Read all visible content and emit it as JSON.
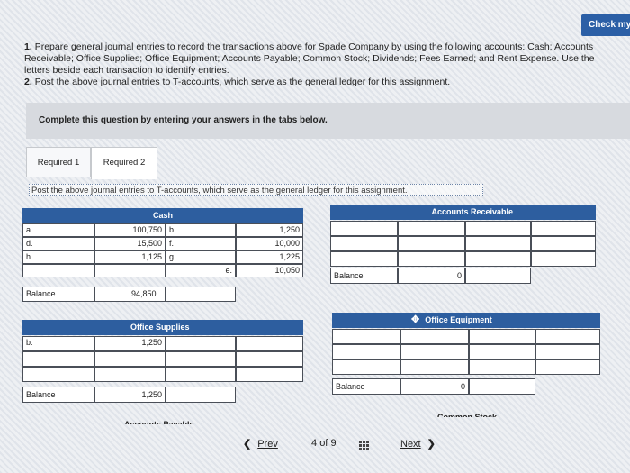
{
  "check_button": "Check my",
  "instructions": {
    "p1_num": "1.",
    "p1": "Prepare general journal entries to record the transactions above for Spade Company by using the following accounts: Cash; Accounts Receivable; Office Supplies; Office Equipment; Accounts Payable; Common Stock; Dividends; Fees Earned; and Rent Expense. Use the letters beside each transaction to identify entries.",
    "p2_num": "2.",
    "p2": "Post the above journal entries to T-accounts, which serve as the general ledger for this assignment."
  },
  "banner": "Complete this question by entering your answers in the tabs below.",
  "tabs": [
    {
      "label": "Required 1"
    },
    {
      "label": "Required 2"
    }
  ],
  "prompt": "Post the above journal entries to T-accounts, which serve as the general ledger for this assignment.",
  "cash": {
    "title": "Cash",
    "debits": [
      {
        "letter": "a.",
        "amount": "100,750"
      },
      {
        "letter": "d.",
        "amount": "15,500"
      },
      {
        "letter": "h.",
        "amount": "1,125"
      }
    ],
    "credits": [
      {
        "letter": "b.",
        "amount": "1,250"
      },
      {
        "letter": "f.",
        "amount": "10,000"
      },
      {
        "letter": "g.",
        "amount": "1,225"
      },
      {
        "letter": "e.",
        "amount": "10,050"
      }
    ],
    "balance_label": "Balance",
    "balance": "94,850"
  },
  "accounts_receivable": {
    "title": "Accounts Receivable",
    "balance_label": "Balance",
    "balance": "0"
  },
  "office_supplies": {
    "title": "Office Supplies",
    "debit_letter": "b.",
    "debit_amount": "1,250",
    "balance_label": "Balance",
    "balance": "1,250"
  },
  "office_equipment": {
    "title": "Office Equipment",
    "move_icon": "✥",
    "balance_label": "Balance",
    "balance": "0"
  },
  "next_titles": {
    "left": "Accounts Payable",
    "right": "Common Stock"
  },
  "nav": {
    "prev": "Prev",
    "page_num": "4",
    "of": "of",
    "page_total": "9",
    "next": "Next"
  }
}
